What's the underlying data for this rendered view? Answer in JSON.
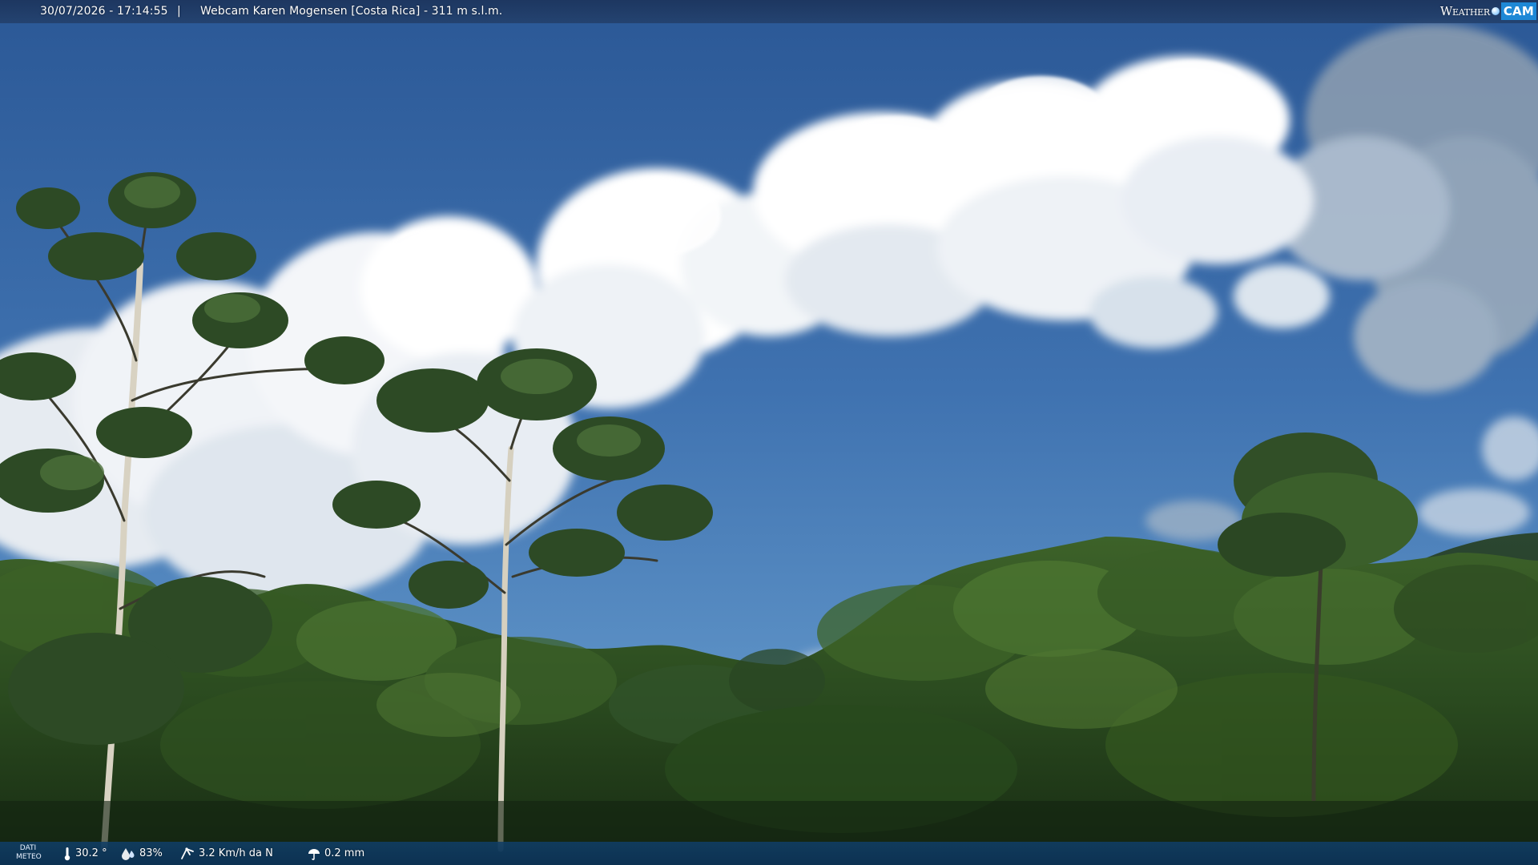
{
  "overlay_top": {
    "datetime": "30/07/2026 - 17:14:55",
    "separator": "|",
    "title": "Webcam Karen Mogensen [Costa Rica]  - 311 m s.l.m.",
    "logo": {
      "weather": "Weather",
      "cam": "CAM"
    }
  },
  "overlay_bottom": {
    "label_line1": "DATI",
    "label_line2": "METEO",
    "temperature": "30.2 °",
    "humidity": "83%",
    "wind": "3.2 Km/h da N",
    "rain": "0.2 mm",
    "icons": {
      "temperature": "thermometer-icon",
      "humidity": "humidity-drop-icon",
      "wind": "wind-icon",
      "rain": "rain-umbrella-icon"
    }
  },
  "colors": {
    "sky_top": "#2d5e9c",
    "sky_bottom": "#5a8fc4",
    "cloud": "#ffffff",
    "forest_dark": "#1c3318",
    "forest_mid": "#2f4f24",
    "forest_light": "#5a7f3a",
    "bar": "#1c345c"
  }
}
